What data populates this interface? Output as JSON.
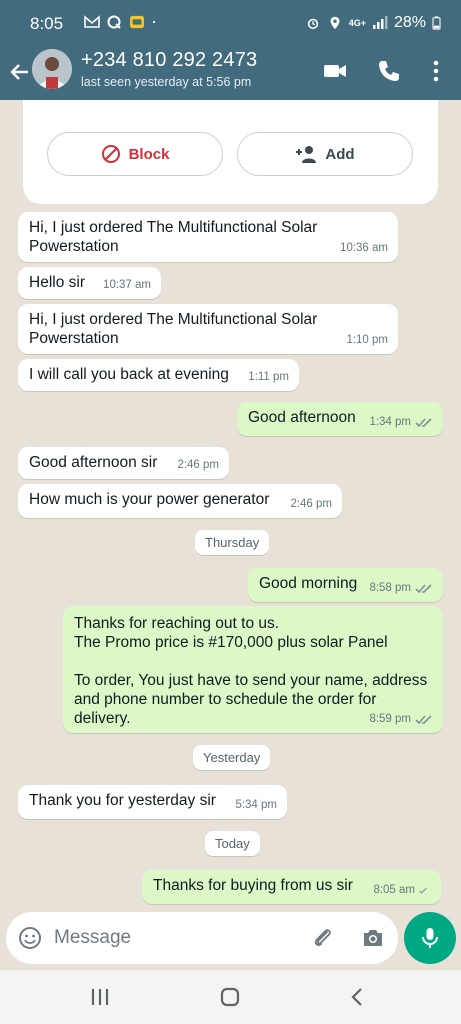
{
  "status_bar": {
    "time": "8:05",
    "battery": "28%",
    "network": "4G+",
    "icons": [
      "gmail-icon",
      "q-icon",
      "app-icon",
      "dot-icon",
      "alarm-icon",
      "location-icon",
      "signal-icon",
      "battery-icon"
    ]
  },
  "header": {
    "name": "+234 810 292 2473",
    "last_seen": "last seen yesterday at 5:56 pm",
    "icons": [
      "back-arrow-icon",
      "avatar",
      "video-call-icon",
      "phone-icon",
      "more-vertical-icon"
    ]
  },
  "card": {
    "block_label": "Block",
    "add_label": "Add"
  },
  "messages": [
    {
      "dir": "in",
      "text": "Hi, I just ordered The Multifunctional Solar\nPowerstation",
      "time": "10:36 am"
    },
    {
      "dir": "in",
      "text": "Hello sir",
      "time": "10:37 am"
    },
    {
      "dir": "in",
      "text": "Hi, I just ordered The Multifunctional Solar\nPowerstation",
      "time": "1:10 pm"
    },
    {
      "dir": "in",
      "text": "I will call you back at evening",
      "time": "1:11 pm"
    },
    {
      "dir": "out",
      "text": "Good afternoon",
      "time": "1:34 pm",
      "status": "read"
    },
    {
      "dir": "in",
      "text": "Good afternoon sir",
      "time": "2:46 pm"
    },
    {
      "dir": "in",
      "text": "How much is your power generator",
      "time": "2:46 pm"
    },
    {
      "dir": "out",
      "text": "Good morning",
      "time": "8:58 pm",
      "status": "read"
    },
    {
      "dir": "out",
      "text": "Thanks for reaching out to us.\nThe Promo price is #170,000 plus solar Panel\n\nTo order, You just have to send your name, address\nand phone number to schedule the order for\ndelivery.",
      "time": "8:59 pm",
      "status": "read"
    },
    {
      "dir": "in",
      "text": "Thank you for yesterday sir",
      "time": "5:34 pm"
    },
    {
      "dir": "out",
      "text": "Thanks for buying from us sir",
      "time": "8:05 am",
      "status": "sent"
    }
  ],
  "date_chips": [
    "Thursday",
    "Yesterday",
    "Today"
  ],
  "input": {
    "placeholder": "Message",
    "icons": [
      "emoji-icon",
      "attach-icon",
      "camera-icon",
      "mic-icon"
    ]
  },
  "nav": {
    "icons": [
      "recent-apps-icon",
      "home-icon",
      "back-icon"
    ]
  },
  "colors": {
    "header": "#426b7d",
    "chat_bg": "#e8e1d8",
    "outgoing_bubble": "#dcf8c6",
    "incoming_bubble": "#ffffff",
    "accent": "#00a884",
    "block_red": "#d32f3a",
    "read_ticks": "#7f929b"
  }
}
